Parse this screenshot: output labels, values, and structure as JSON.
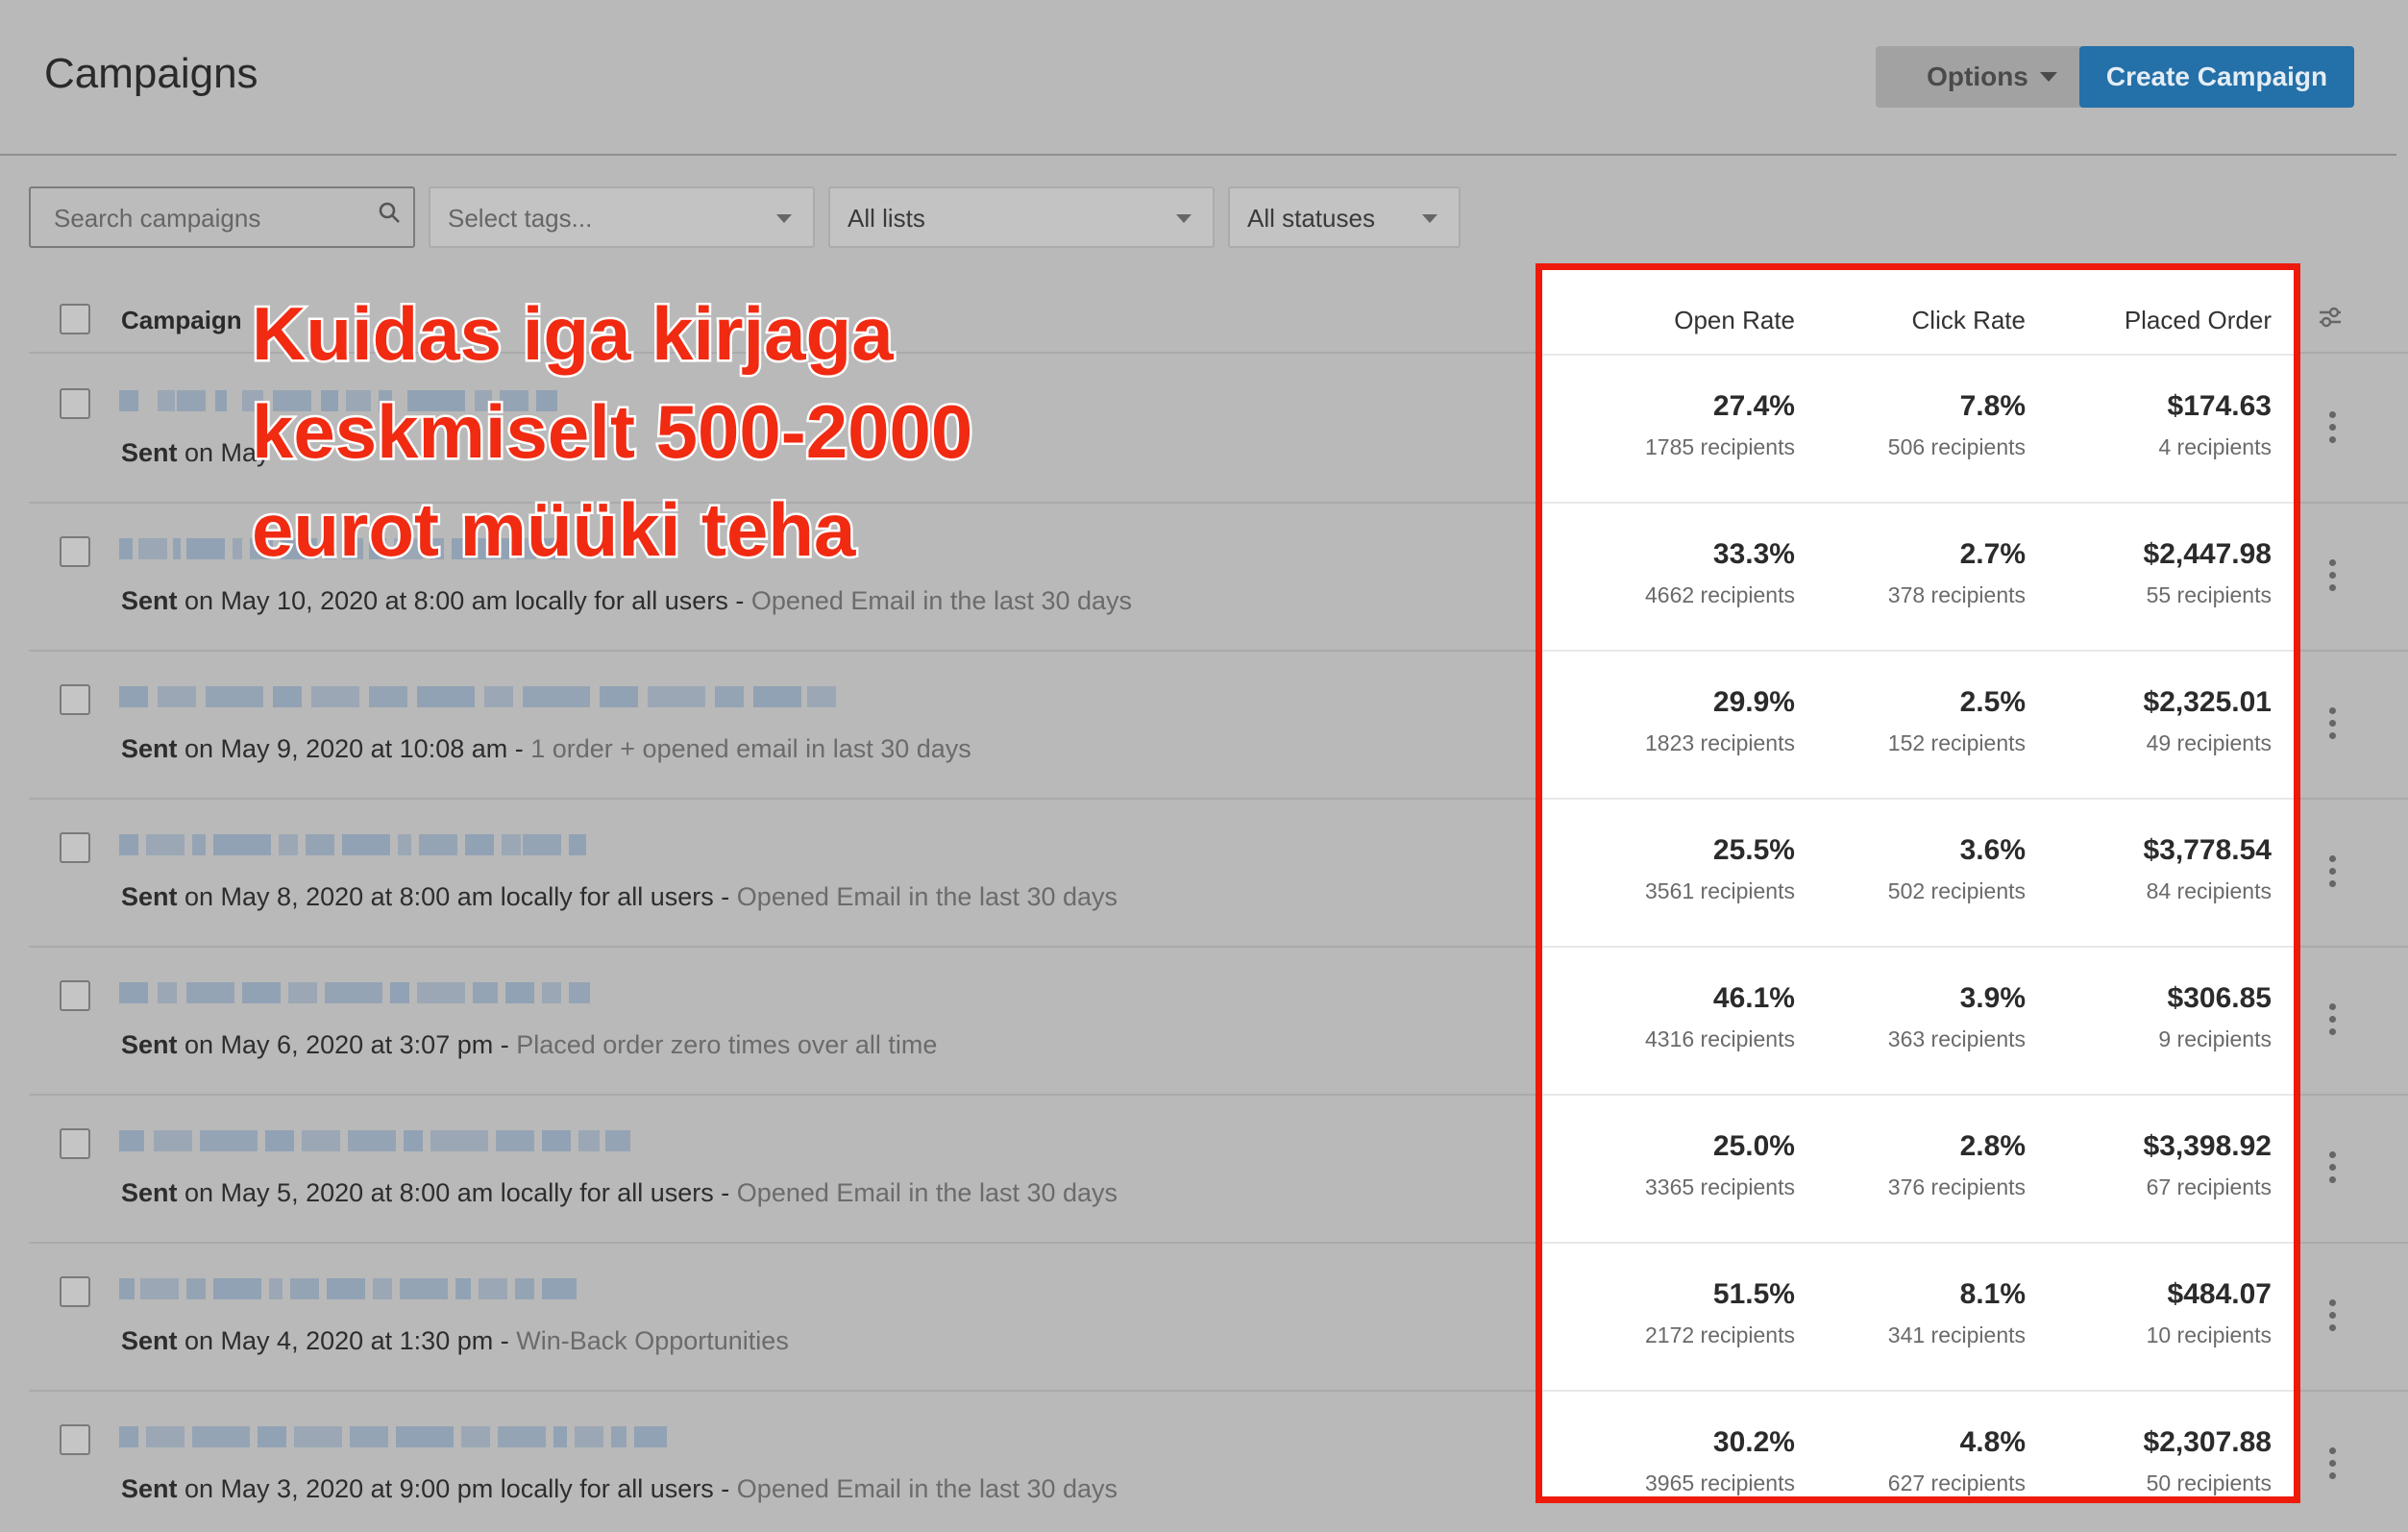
{
  "header": {
    "title": "Campaigns",
    "options_label": "Options",
    "create_label": "Create Campaign"
  },
  "filters": {
    "search_placeholder": "Search campaigns",
    "tags_placeholder": "Select tags...",
    "lists_value": "All lists",
    "statuses_value": "All statuses"
  },
  "columns": {
    "campaign": "Campaign",
    "open_rate": "Open Rate",
    "click_rate": "Click Rate",
    "placed_order": "Placed Order"
  },
  "overlay_text": [
    "Kuidas iga kirjaga",
    "keskmiselt 500-2000",
    "eurot müüki teha"
  ],
  "rows": [
    {
      "sent_prefix": "Sent",
      "sent": " on May ",
      "segment": "",
      "open": "27.4%",
      "open_rec": "1785 recipients",
      "click": "7.8%",
      "click_rec": "506 recipients",
      "order": "$174.63",
      "order_rec": "4 recipients"
    },
    {
      "sent_prefix": "Sent",
      "sent": " on May 10, 2020 at 8:00 am locally for all users - ",
      "segment": "Opened Email in the last 30 days",
      "open": "33.3%",
      "open_rec": "4662 recipients",
      "click": "2.7%",
      "click_rec": "378 recipients",
      "order": "$2,447.98",
      "order_rec": "55 recipients"
    },
    {
      "sent_prefix": "Sent",
      "sent": " on May 9, 2020 at 10:08 am - ",
      "segment": "1 order + opened email in last 30 days",
      "open": "29.9%",
      "open_rec": "1823 recipients",
      "click": "2.5%",
      "click_rec": "152 recipients",
      "order": "$2,325.01",
      "order_rec": "49 recipients"
    },
    {
      "sent_prefix": "Sent",
      "sent": " on May 8, 2020 at 8:00 am locally for all users - ",
      "segment": "Opened Email in the last 30 days",
      "open": "25.5%",
      "open_rec": "3561 recipients",
      "click": "3.6%",
      "click_rec": "502 recipients",
      "order": "$3,778.54",
      "order_rec": "84 recipients"
    },
    {
      "sent_prefix": "Sent",
      "sent": " on May 6, 2020 at 3:07 pm - ",
      "segment": "Placed order zero times over all time",
      "open": "46.1%",
      "open_rec": "4316 recipients",
      "click": "3.9%",
      "click_rec": "363 recipients",
      "order": "$306.85",
      "order_rec": "9 recipients"
    },
    {
      "sent_prefix": "Sent",
      "sent": " on May 5, 2020 at 8:00 am locally for all users - ",
      "segment": "Opened Email in the last 30 days",
      "open": "25.0%",
      "open_rec": "3365 recipients",
      "click": "2.8%",
      "click_rec": "376 recipients",
      "order": "$3,398.92",
      "order_rec": "67 recipients"
    },
    {
      "sent_prefix": "Sent",
      "sent": " on May 4, 2020 at 1:30 pm - ",
      "segment": "Win-Back Opportunities",
      "open": "51.5%",
      "open_rec": "2172 recipients",
      "click": "8.1%",
      "click_rec": "341 recipients",
      "order": "$484.07",
      "order_rec": "10 recipients"
    },
    {
      "sent_prefix": "Sent",
      "sent": " on May 3, 2020 at 9:00 pm locally for all users - ",
      "segment": "Opened Email in the last 30 days",
      "open": "30.2%",
      "open_rec": "3965 recipients",
      "click": "4.8%",
      "click_rec": "627 recipients",
      "order": "$2,307.88",
      "order_rec": "50 recipients"
    }
  ],
  "colors": {
    "accent": "#2470a8",
    "highlight_border": "#ee1a0b",
    "overlay_text": "#f12a12"
  }
}
